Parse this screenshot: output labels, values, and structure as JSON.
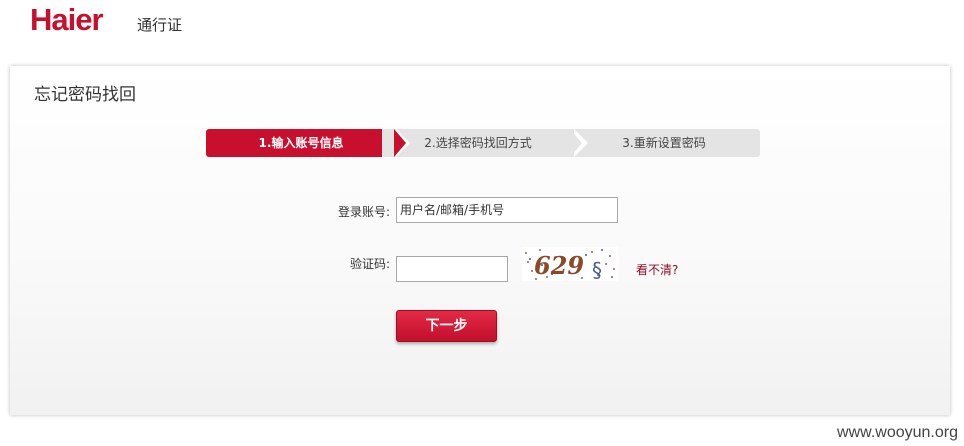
{
  "header": {
    "logo_text": "Haier",
    "logo_sub": "通行证"
  },
  "panel": {
    "title": "忘记密码找回"
  },
  "steps": [
    {
      "label": "1.输入账号信息",
      "active": true
    },
    {
      "label": "2.选择密码找回方式",
      "active": false
    },
    {
      "label": "3.重新设置密码",
      "active": false
    }
  ],
  "form": {
    "account_label": "登录账号:",
    "account_value": "用户名/邮箱/手机号",
    "code_label": "验证码:",
    "code_value": "",
    "captcha_text": "629",
    "refresh_label": "看不清?",
    "next_label": "下一步"
  },
  "watermark": "www.wooyun.org",
  "colors": {
    "brand": "#c8102e",
    "step_inactive": "#e4e4e4",
    "link": "#8b1028"
  }
}
